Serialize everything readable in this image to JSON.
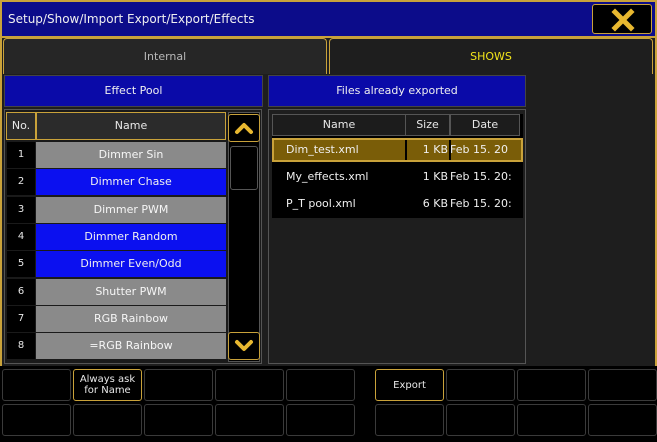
{
  "window": {
    "title": "Setup/Show/Import Export/Export/Effects",
    "close_icon": "close-x-icon",
    "accent_color": "#c9a23a",
    "title_bg_color": "#0c0c8a"
  },
  "tabs": [
    {
      "label": "Internal",
      "active": false
    },
    {
      "label": "SHOWS",
      "active": true,
      "color": "#f2e41a"
    }
  ],
  "effect_pool": {
    "header": "Effect Pool",
    "columns": [
      "No.",
      "Name"
    ],
    "rows": [
      {
        "no": "1",
        "name": "Dimmer Sin",
        "color": "grey"
      },
      {
        "no": "2",
        "name": "Dimmer Chase",
        "color": "blue"
      },
      {
        "no": "3",
        "name": "Dimmer PWM",
        "color": "grey"
      },
      {
        "no": "4",
        "name": "Dimmer Random",
        "color": "blue"
      },
      {
        "no": "5",
        "name": "Dimmer Even/Odd",
        "color": "blue"
      },
      {
        "no": "6",
        "name": "Shutter PWM",
        "color": "grey"
      },
      {
        "no": "7",
        "name": "RGB Rainbow",
        "color": "grey"
      },
      {
        "no": "8",
        "name": "=RGB Rainbow",
        "color": "grey"
      }
    ],
    "scroll_up_icon": "chevron-up-icon",
    "scroll_down_icon": "chevron-down-icon"
  },
  "exported_files": {
    "header": "Files already exported",
    "columns": [
      "Name",
      "Size",
      "Date"
    ],
    "rows": [
      {
        "name": "Dim_test.xml",
        "size": "1 KB",
        "date": "Feb 15. 20",
        "selected": true
      },
      {
        "name": "My_effects.xml",
        "size": "1 KB",
        "date": "Feb 15. 20:",
        "selected": false
      },
      {
        "name": "P_T pool.xml",
        "size": "6 KB",
        "date": "Feb 15. 20:",
        "selected": false
      }
    ]
  },
  "command_buttons": {
    "row1": [
      "",
      "Always ask for Name",
      "",
      "",
      "",
      "Export",
      "",
      "",
      ""
    ],
    "row2": [
      "",
      "",
      "",
      "",
      "",
      "",
      "",
      "",
      ""
    ]
  }
}
